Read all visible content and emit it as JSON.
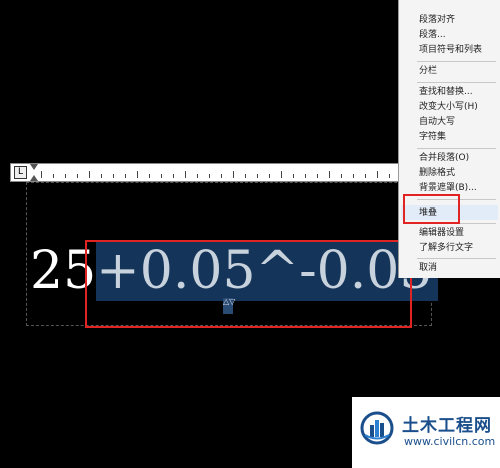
{
  "ruler": {
    "tabstop_symbol": "L"
  },
  "editor": {
    "base_text": "25",
    "selected_text": "+0.05^-0.05",
    "caret_symbol": "^",
    "stack_handle": "△▽"
  },
  "context_menu": {
    "items": [
      "段落对齐",
      "段落...",
      "项目符号和列表",
      "分栏",
      "查找和替换...",
      "改变大小写(H)",
      "自动大写",
      "字符集",
      "合并段落(O)",
      "删除格式",
      "背景遮罩(B)...",
      "堆叠",
      "编辑器设置",
      "了解多行文字",
      "取消"
    ],
    "highlighted_item": "堆叠"
  },
  "watermark": {
    "title": "土木工程网",
    "url": "www.civilcn.com"
  },
  "colors": {
    "highlight_box": "#e02424",
    "selection_bg": "#14345a",
    "brand": "#1a4f8c"
  }
}
